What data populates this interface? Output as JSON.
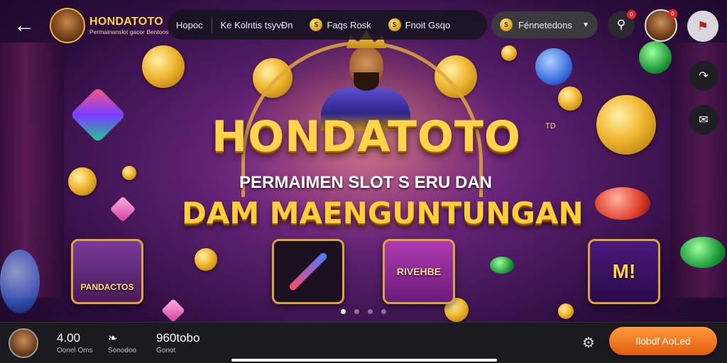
{
  "header": {
    "back_icon": "arrow-left-icon",
    "brand_name": "HONDATOTO",
    "brand_tagline": "Permainanslot gacor Bentoos",
    "nav": [
      {
        "label": "Hopoc",
        "icon": ""
      },
      {
        "label": "Ke Kolntis tsyvÐn",
        "icon": ""
      },
      {
        "label": "Faqs Rosk",
        "icon": "coin-icon"
      },
      {
        "label": "Fnoit Gsqo",
        "icon": "coin-icon"
      }
    ],
    "dropdown_label": "Fénnetedons",
    "notification_count": "0",
    "user_badge": "0"
  },
  "hero": {
    "title": "HONDATOTO",
    "tm": "TD",
    "subtitle_1": "PERMAIMEN SLOT S ERU DAN",
    "subtitle_2": "DAM MAENGUNTUNGAN"
  },
  "cards": [
    {
      "label": "PANDACTOS"
    },
    {
      "label": ""
    },
    {
      "label": "RIVEHBE"
    },
    {
      "label": "M!"
    }
  ],
  "carousel": {
    "count": 4,
    "active": 0
  },
  "bottom": {
    "stat_1_value": "4.00",
    "stat_1_label": "Oonel Oms",
    "stat_2_label": "Sonodoo",
    "stat_3_value": "960tobo",
    "stat_3_label": "Gonot",
    "cta_label": "Ilobdf AoLed"
  },
  "colors": {
    "accent_gold": "#ffd34a",
    "cta_orange": "#e25d0c",
    "bg_purple": "#5a1f6e"
  }
}
